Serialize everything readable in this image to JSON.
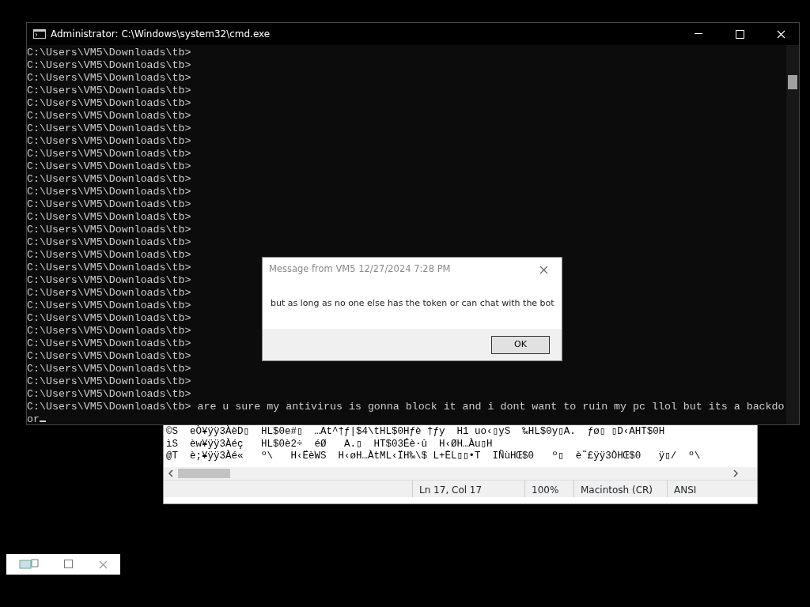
{
  "console_window": {
    "title": "Administrator: C:\\Windows\\system32\\cmd.exe",
    "lines": [
      "C:\\Users\\VM5\\Downloads\\tb>",
      "C:\\Users\\VM5\\Downloads\\tb>",
      "C:\\Users\\VM5\\Downloads\\tb>",
      "C:\\Users\\VM5\\Downloads\\tb>",
      "C:\\Users\\VM5\\Downloads\\tb>",
      "C:\\Users\\VM5\\Downloads\\tb>",
      "C:\\Users\\VM5\\Downloads\\tb>",
      "C:\\Users\\VM5\\Downloads\\tb>",
      "C:\\Users\\VM5\\Downloads\\tb>",
      "C:\\Users\\VM5\\Downloads\\tb>",
      "C:\\Users\\VM5\\Downloads\\tb>",
      "C:\\Users\\VM5\\Downloads\\tb>",
      "C:\\Users\\VM5\\Downloads\\tb>",
      "C:\\Users\\VM5\\Downloads\\tb>",
      "C:\\Users\\VM5\\Downloads\\tb>",
      "C:\\Users\\VM5\\Downloads\\tb>",
      "C:\\Users\\VM5\\Downloads\\tb>",
      "C:\\Users\\VM5\\Downloads\\tb>",
      "C:\\Users\\VM5\\Downloads\\tb>",
      "C:\\Users\\VM5\\Downloads\\tb>",
      "C:\\Users\\VM5\\Downloads\\tb>",
      "C:\\Users\\VM5\\Downloads\\tb>",
      "C:\\Users\\VM5\\Downloads\\tb>",
      "C:\\Users\\VM5\\Downloads\\tb>",
      "C:\\Users\\VM5\\Downloads\\tb>",
      "C:\\Users\\VM5\\Downloads\\tb>",
      "C:\\Users\\VM5\\Downloads\\tb>",
      "C:\\Users\\VM5\\Downloads\\tb>",
      "C:\\Users\\VM5\\Downloads\\tb> are u sure my antivirus is gonna block it and i dont want to ruin my pc llol but its a backdo",
      "or"
    ]
  },
  "text_editor": {
    "lines": [
      "©S  eÒ¥ÿÿ3ÀèD▯  HL$0e#▯  …At^†ƒ|$4\\tHL$0Hƒè †ƒy  H1 uo‹▯yS  ‰HL$0y▯A.  ƒø▯ ▯D‹AHT$0H",
      "ìS  èw¥ÿÿ3Àéç   HL$0è2÷  éØ   A.▯  HT$03Éè·û  H‹ØH…Àu▯H",
      "@T  è;¥ÿÿ3Àé«   º\\   H‹ËèWS  H‹øH…ÀtML‹ÏH‰\\$ L+ËL▯▯•T  IÑùHŒ$0   º▯  è˜£ÿÿ3ÒHŒ$0   ÿ▯/  º\\"
    ],
    "status": [
      "Ln 17, Col 17",
      "100%",
      "Macintosh (CR)",
      "ANSI"
    ]
  },
  "message_box": {
    "title": "Message from VM5 12/27/2024 7:28 PM",
    "message": "but as long as no one else has the token or can chat with the bot",
    "button": "OK"
  }
}
